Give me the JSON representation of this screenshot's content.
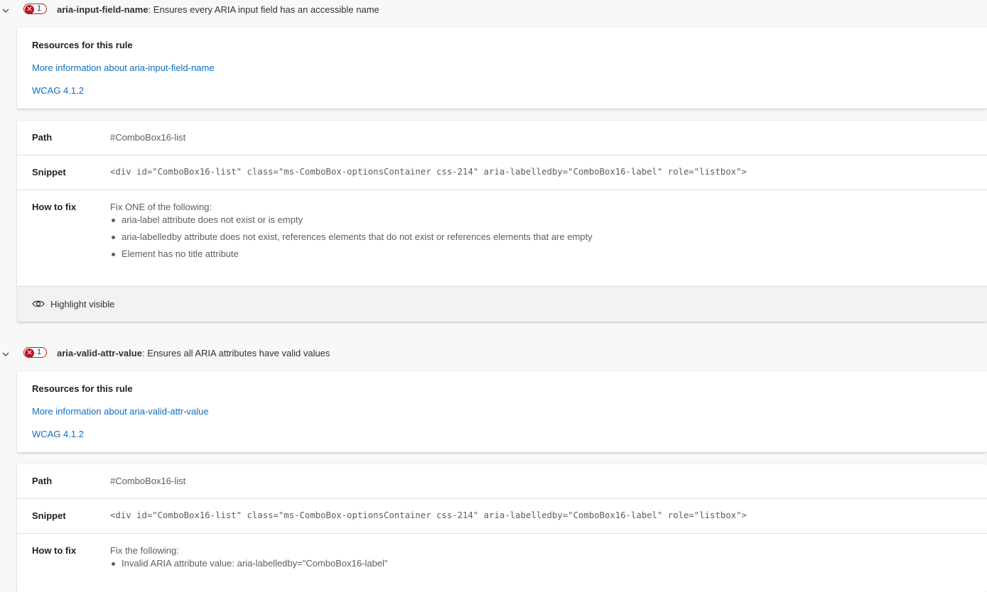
{
  "rules": [
    {
      "id": "aria-input-field-name",
      "description": ": Ensures every ARIA input field has an accessible name",
      "failure_count": "1",
      "resources": {
        "title": "Resources for this rule",
        "more_info": "More information about aria-input-field-name",
        "wcag": "WCAG 4.1.2"
      },
      "instance": {
        "path_label": "Path",
        "path_value": "#ComboBox16-list",
        "snippet_label": "Snippet",
        "snippet_value": "<div id=\"ComboBox16-list\" class=\"ms-ComboBox-optionsContainer css-214\" aria-labelledby=\"ComboBox16-label\" role=\"listbox\">",
        "fix_label": "How to fix",
        "fix_intro": "Fix ONE of the following:",
        "fix_items": [
          "aria-label attribute does not exist or is empty",
          "aria-labelledby attribute does not exist, references elements that do not exist or references elements that are empty",
          "Element has no title attribute"
        ],
        "highlight_label": "Highlight visible"
      }
    },
    {
      "id": "aria-valid-attr-value",
      "description": ": Ensures all ARIA attributes have valid values",
      "failure_count": "1",
      "resources": {
        "title": "Resources for this rule",
        "more_info": "More information about aria-valid-attr-value",
        "wcag": "WCAG 4.1.2"
      },
      "instance": {
        "path_label": "Path",
        "path_value": "#ComboBox16-list",
        "snippet_label": "Snippet",
        "snippet_value": "<div id=\"ComboBox16-list\" class=\"ms-ComboBox-optionsContainer css-214\" aria-labelledby=\"ComboBox16-label\" role=\"listbox\">",
        "fix_label": "How to fix",
        "fix_intro": "Fix the following:",
        "fix_items": [
          "Invalid ARIA attribute value: aria-labelledby=\"ComboBox16-label\""
        ]
      }
    }
  ],
  "icons": {
    "chevron": "chevron-down-icon",
    "failure": "error-x-icon",
    "highlight": "eye-icon"
  },
  "colors": {
    "link": "#106ebe",
    "error": "#c50f1f"
  }
}
